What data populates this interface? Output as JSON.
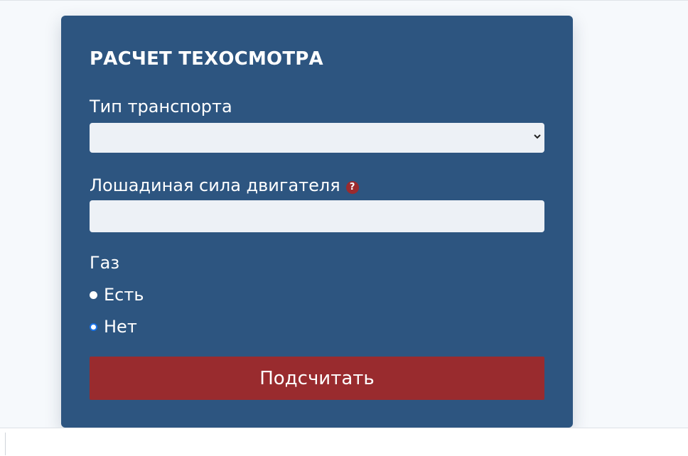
{
  "form": {
    "title": "РАСЧЕТ ТЕХОСМОТРА",
    "transport_type": {
      "label": "Тип транспорта",
      "selected_value": ""
    },
    "horsepower": {
      "label": "Лошадиная сила двигателя",
      "help_icon": "question-mark-icon",
      "help_glyph": "?",
      "value": ""
    },
    "gas": {
      "label": "Газ",
      "options": [
        {
          "label": "Есть",
          "checked": false
        },
        {
          "label": "Нет",
          "checked": true
        }
      ]
    },
    "submit_label": "Подсчитать"
  },
  "colors": {
    "card_background": "#2d5580",
    "button_background": "#992b2e",
    "input_background": "#edf1f6",
    "help_icon_background": "#9b2b2e",
    "radio_checked_border": "#1a73e8"
  }
}
